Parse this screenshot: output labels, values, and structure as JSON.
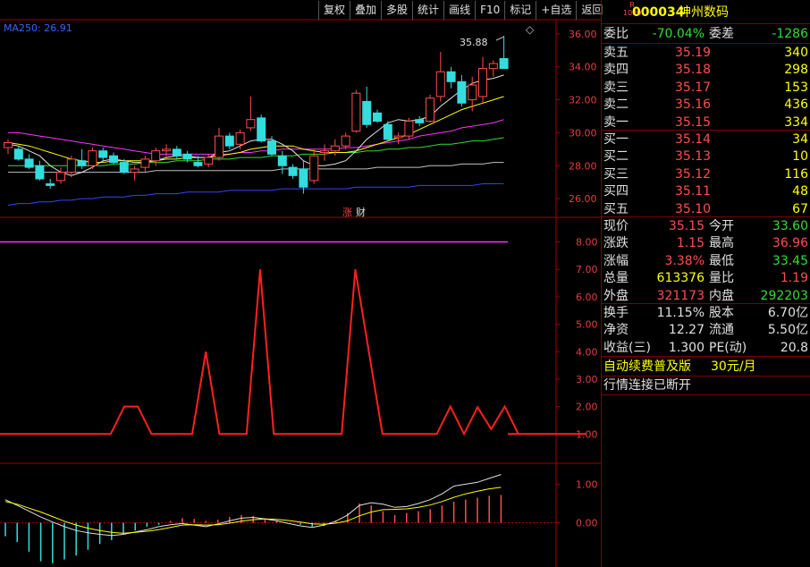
{
  "toolbar": {
    "buttons": [
      "复权",
      "叠加",
      "多股",
      "统计",
      "画线",
      "F10",
      "标记",
      "+自选",
      "返回"
    ]
  },
  "main_chart": {
    "ma_label": "MA250: 26.91",
    "max_label": "35.88",
    "y_ticks": [
      "36.00",
      "34.00",
      "32.00",
      "30.00",
      "28.00",
      "26.00"
    ],
    "markers": [
      "涨",
      "财"
    ],
    "icon": "diamond-icon"
  },
  "indicator_chart": {
    "y_ticks": [
      "8.00",
      "7.00",
      "6.00",
      "5.00",
      "4.00",
      "3.00",
      "2.00",
      "1.00"
    ]
  },
  "macd_chart": {
    "y_ticks": [
      "1.00",
      "0.00"
    ]
  },
  "stock": {
    "badge_top": "R",
    "badge_bottom": "1000",
    "code": "000034",
    "name": "神州数码"
  },
  "ratio": {
    "label1": "委比",
    "value1": "-70.04%",
    "label2": "委差",
    "value2": "-1286"
  },
  "asks": [
    {
      "label": "卖五",
      "price": "35.19",
      "vol": "340"
    },
    {
      "label": "卖四",
      "price": "35.18",
      "vol": "298"
    },
    {
      "label": "卖三",
      "price": "35.17",
      "vol": "153"
    },
    {
      "label": "卖二",
      "price": "35.16",
      "vol": "436"
    },
    {
      "label": "卖一",
      "price": "35.15",
      "vol": "334"
    }
  ],
  "bids": [
    {
      "label": "买一",
      "price": "35.14",
      "vol": "34"
    },
    {
      "label": "买二",
      "price": "35.13",
      "vol": "10"
    },
    {
      "label": "买三",
      "price": "35.12",
      "vol": "116"
    },
    {
      "label": "买四",
      "price": "35.11",
      "vol": "48"
    },
    {
      "label": "买五",
      "price": "35.10",
      "vol": "67"
    }
  ],
  "quote": [
    {
      "l1": "现价",
      "v1": "35.15",
      "c1": "red",
      "l2": "今开",
      "v2": "33.60",
      "c2": "grn"
    },
    {
      "l1": "涨跌",
      "v1": "1.15",
      "c1": "red",
      "l2": "最高",
      "v2": "36.96",
      "c2": "red"
    },
    {
      "l1": "涨幅",
      "v1": "3.38%",
      "c1": "red",
      "l2": "最低",
      "v2": "33.45",
      "c2": "grn"
    },
    {
      "l1": "总量",
      "v1": "613376",
      "c1": "yel",
      "l2": "量比",
      "v2": "1.19",
      "c2": "red"
    },
    {
      "l1": "外盘",
      "v1": "321173",
      "c1": "red",
      "l2": "内盘",
      "v2": "292203",
      "c2": "grn"
    }
  ],
  "fund": [
    {
      "l1": "换手",
      "v1": "11.15%",
      "l2": "股本",
      "v2": "6.70亿"
    },
    {
      "l1": "净资",
      "v1": "12.27",
      "l2": "流通",
      "v2": "5.50亿"
    },
    {
      "l1": "收益(三)",
      "v1": "1.300",
      "l2": "PE(动)",
      "v2": "20.8"
    }
  ],
  "promo": {
    "text": "自动续费普及版",
    "price": "30元/月"
  },
  "status": {
    "text": "行情连接已断开"
  },
  "colors": {
    "up": "#ff4d4d",
    "down": "#33dddd",
    "axis": "#a00000",
    "ma5": "#e0e0e0",
    "ma10": "#ffff00",
    "ma20": "#ff33ff",
    "ma30": "#33dd33",
    "ma60": "#c0c0c0",
    "ma250": "#3344ff",
    "indicator": "#ff2020",
    "macd_bar_up": "#ff4d4d",
    "macd_bar_down": "#33dddd"
  },
  "chart_data": {
    "type": "candlestick",
    "price_range": [
      25.3,
      36.7
    ],
    "candles": [
      {
        "o": 29.1,
        "h": 29.6,
        "l": 28.7,
        "c": 29.4
      },
      {
        "o": 29.0,
        "h": 29.2,
        "l": 28.3,
        "c": 28.4
      },
      {
        "o": 28.4,
        "h": 28.7,
        "l": 27.8,
        "c": 27.9
      },
      {
        "o": 28.0,
        "h": 28.3,
        "l": 27.1,
        "c": 27.2
      },
      {
        "o": 26.9,
        "h": 27.2,
        "l": 26.6,
        "c": 26.8
      },
      {
        "o": 27.1,
        "h": 27.9,
        "l": 26.9,
        "c": 27.6
      },
      {
        "o": 27.6,
        "h": 28.6,
        "l": 27.3,
        "c": 28.4
      },
      {
        "o": 28.3,
        "h": 29.0,
        "l": 27.8,
        "c": 28.0
      },
      {
        "o": 28.0,
        "h": 29.1,
        "l": 27.8,
        "c": 28.9
      },
      {
        "o": 28.9,
        "h": 29.1,
        "l": 28.2,
        "c": 28.5
      },
      {
        "o": 28.6,
        "h": 28.8,
        "l": 28.1,
        "c": 28.2
      },
      {
        "o": 28.2,
        "h": 28.4,
        "l": 27.5,
        "c": 27.6
      },
      {
        "o": 27.6,
        "h": 28.0,
        "l": 27.1,
        "c": 27.8
      },
      {
        "o": 27.9,
        "h": 28.6,
        "l": 27.6,
        "c": 28.4
      },
      {
        "o": 28.3,
        "h": 29.1,
        "l": 28.0,
        "c": 28.9
      },
      {
        "o": 28.9,
        "h": 29.3,
        "l": 28.5,
        "c": 29.0
      },
      {
        "o": 29.0,
        "h": 29.2,
        "l": 28.4,
        "c": 28.6
      },
      {
        "o": 28.7,
        "h": 28.9,
        "l": 28.2,
        "c": 28.4
      },
      {
        "o": 28.2,
        "h": 28.6,
        "l": 27.9,
        "c": 28.0
      },
      {
        "o": 28.1,
        "h": 28.7,
        "l": 27.9,
        "c": 28.5
      },
      {
        "o": 28.5,
        "h": 30.3,
        "l": 28.3,
        "c": 29.8
      },
      {
        "o": 29.8,
        "h": 30.0,
        "l": 29.0,
        "c": 29.2
      },
      {
        "o": 29.3,
        "h": 30.2,
        "l": 29.0,
        "c": 30.0
      },
      {
        "o": 30.3,
        "h": 32.2,
        "l": 30.1,
        "c": 30.8
      },
      {
        "o": 30.9,
        "h": 31.1,
        "l": 29.4,
        "c": 29.5
      },
      {
        "o": 29.5,
        "h": 29.8,
        "l": 28.6,
        "c": 28.7
      },
      {
        "o": 28.6,
        "h": 28.9,
        "l": 27.5,
        "c": 28.0
      },
      {
        "o": 27.9,
        "h": 28.1,
        "l": 27.2,
        "c": 27.4
      },
      {
        "o": 27.8,
        "h": 28.3,
        "l": 26.3,
        "c": 26.7
      },
      {
        "o": 27.1,
        "h": 29.0,
        "l": 26.9,
        "c": 28.6
      },
      {
        "o": 28.8,
        "h": 29.3,
        "l": 28.3,
        "c": 28.9
      },
      {
        "o": 28.9,
        "h": 29.6,
        "l": 28.6,
        "c": 29.2
      },
      {
        "o": 29.2,
        "h": 30.0,
        "l": 29.0,
        "c": 29.8
      },
      {
        "o": 30.1,
        "h": 32.6,
        "l": 30.0,
        "c": 32.4
      },
      {
        "o": 31.9,
        "h": 32.8,
        "l": 30.3,
        "c": 30.5
      },
      {
        "o": 31.2,
        "h": 31.4,
        "l": 30.6,
        "c": 30.7
      },
      {
        "o": 30.5,
        "h": 30.7,
        "l": 29.5,
        "c": 29.6
      },
      {
        "o": 29.7,
        "h": 30.0,
        "l": 29.3,
        "c": 29.8
      },
      {
        "o": 29.8,
        "h": 30.9,
        "l": 29.6,
        "c": 30.7
      },
      {
        "o": 30.8,
        "h": 31.0,
        "l": 30.4,
        "c": 30.6
      },
      {
        "o": 30.7,
        "h": 32.3,
        "l": 30.6,
        "c": 32.1
      },
      {
        "o": 32.2,
        "h": 34.9,
        "l": 31.9,
        "c": 33.7
      },
      {
        "o": 33.7,
        "h": 34.0,
        "l": 32.7,
        "c": 33.1
      },
      {
        "o": 33.1,
        "h": 33.5,
        "l": 31.6,
        "c": 31.8
      },
      {
        "o": 32.0,
        "h": 33.4,
        "l": 31.3,
        "c": 32.9
      },
      {
        "o": 32.2,
        "h": 34.6,
        "l": 31.8,
        "c": 33.9
      },
      {
        "o": 33.9,
        "h": 34.4,
        "l": 33.4,
        "c": 34.2
      },
      {
        "o": 34.5,
        "h": 35.88,
        "l": 33.9,
        "c": 33.9
      }
    ],
    "ma5": [
      29.3,
      29.2,
      28.9,
      28.6,
      28.0,
      27.6,
      27.4,
      27.6,
      27.9,
      28.3,
      28.4,
      28.3,
      28.2,
      28.2,
      28.3,
      28.5,
      28.6,
      28.6,
      28.5,
      28.5,
      28.8,
      28.9,
      29.2,
      29.5,
      29.6,
      29.6,
      29.3,
      28.9,
      28.3,
      28.0,
      28.0,
      28.1,
      28.3,
      28.9,
      29.6,
      30.1,
      30.6,
      30.8,
      30.7,
      30.8,
      31.0,
      31.6,
      32.1,
      32.6,
      33.0,
      33.2,
      33.3,
      33.5
    ],
    "ma10": [
      29.4,
      29.3,
      29.2,
      29.0,
      28.8,
      28.6,
      28.4,
      28.3,
      28.2,
      28.2,
      28.3,
      28.3,
      28.3,
      28.3,
      28.3,
      28.4,
      28.4,
      28.5,
      28.5,
      28.5,
      28.6,
      28.7,
      28.8,
      29.0,
      29.1,
      29.2,
      29.2,
      29.2,
      29.0,
      28.9,
      28.8,
      28.8,
      28.8,
      28.9,
      29.1,
      29.3,
      29.5,
      29.7,
      29.9,
      30.2,
      30.5,
      30.8,
      31.1,
      31.4,
      31.6,
      31.8,
      32.0,
      32.2
    ],
    "ma20": [
      30.0,
      30.0,
      29.9,
      29.8,
      29.7,
      29.6,
      29.5,
      29.4,
      29.3,
      29.2,
      29.1,
      29.0,
      28.9,
      28.8,
      28.7,
      28.7,
      28.7,
      28.7,
      28.7,
      28.7,
      28.7,
      28.7,
      28.8,
      28.8,
      28.9,
      28.9,
      29.0,
      29.0,
      29.0,
      29.0,
      29.0,
      29.0,
      29.1,
      29.1,
      29.2,
      29.3,
      29.4,
      29.5,
      29.6,
      29.8,
      29.9,
      30.0,
      30.1,
      30.3,
      30.4,
      30.5,
      30.6,
      30.8
    ],
    "ma30": [
      28.0,
      28.0,
      28.0,
      28.0,
      28.0,
      28.0,
      28.0,
      28.0,
      28.0,
      28.0,
      28.1,
      28.1,
      28.1,
      28.2,
      28.2,
      28.2,
      28.3,
      28.3,
      28.3,
      28.4,
      28.4,
      28.4,
      28.5,
      28.5,
      28.5,
      28.6,
      28.6,
      28.6,
      28.7,
      28.7,
      28.7,
      28.8,
      28.8,
      28.8,
      28.9,
      28.9,
      29.0,
      29.0,
      29.1,
      29.1,
      29.2,
      29.3,
      29.3,
      29.4,
      29.5,
      29.5,
      29.6,
      29.7
    ],
    "ma60": [
      27.6,
      27.6,
      27.6,
      27.6,
      27.6,
      27.6,
      27.6,
      27.6,
      27.6,
      27.6,
      27.6,
      27.6,
      27.6,
      27.6,
      27.7,
      27.7,
      27.7,
      27.7,
      27.7,
      27.7,
      27.7,
      27.7,
      27.7,
      27.7,
      27.7,
      27.7,
      27.8,
      27.8,
      27.8,
      27.8,
      27.8,
      27.8,
      27.8,
      27.8,
      27.8,
      27.9,
      27.9,
      27.9,
      27.9,
      27.9,
      28.0,
      28.0,
      28.0,
      28.1,
      28.1,
      28.1,
      28.2,
      28.2
    ],
    "ma250": [
      25.6,
      25.7,
      25.7,
      25.8,
      25.8,
      25.9,
      25.9,
      26.0,
      26.0,
      26.1,
      26.1,
      26.1,
      26.2,
      26.2,
      26.3,
      26.3,
      26.3,
      26.4,
      26.4,
      26.4,
      26.4,
      26.5,
      26.5,
      26.5,
      26.5,
      26.5,
      26.6,
      26.6,
      26.6,
      26.6,
      26.6,
      26.6,
      26.6,
      26.7,
      26.7,
      26.7,
      26.7,
      26.7,
      26.7,
      26.8,
      26.8,
      26.8,
      26.8,
      26.8,
      26.8,
      26.9,
      26.9,
      26.91
    ],
    "indicator": {
      "range": [
        0,
        8.8
      ],
      "values": [
        1,
        1,
        1,
        1,
        1,
        2,
        2,
        1,
        1,
        1,
        1,
        4,
        1,
        1,
        1,
        7,
        1,
        1,
        1,
        1,
        1,
        1,
        7,
        4,
        1,
        1,
        1,
        1,
        1,
        2,
        1,
        1.98,
        1.18,
        2,
        1,
        1,
        1,
        1,
        1,
        1
      ],
      "x_start": 63,
      "x_step": 15.2,
      "level_line": 8
    },
    "macd": {
      "range": [
        -1.1,
        1.45
      ],
      "dif": [
        0.6,
        0.45,
        0.3,
        0.15,
        0.02,
        -0.1,
        -0.2,
        -0.26,
        -0.3,
        -0.33,
        -0.3,
        -0.24,
        -0.18,
        -0.1,
        -0.05,
        -0.02,
        -0.06,
        -0.1,
        -0.03,
        0.05,
        0.12,
        0.14,
        0.1,
        0.05,
        -0.02,
        -0.08,
        -0.12,
        -0.06,
        0.04,
        0.2,
        0.45,
        0.52,
        0.48,
        0.4,
        0.42,
        0.5,
        0.6,
        0.75,
        0.95,
        1.0,
        1.05,
        1.15,
        1.25
      ],
      "dea": [
        0.55,
        0.48,
        0.38,
        0.28,
        0.16,
        0.04,
        -0.06,
        -0.14,
        -0.2,
        -0.25,
        -0.27,
        -0.25,
        -0.22,
        -0.18,
        -0.12,
        -0.06,
        -0.05,
        -0.06,
        -0.05,
        -0.01,
        0.04,
        0.08,
        0.1,
        0.09,
        0.06,
        0.02,
        -0.03,
        -0.04,
        -0.01,
        0.05,
        0.18,
        0.28,
        0.34,
        0.35,
        0.36,
        0.4,
        0.46,
        0.55,
        0.66,
        0.75,
        0.82,
        0.88,
        0.92
      ],
      "bars": [
        -0.35,
        -0.5,
        -0.75,
        -1.0,
        -1.05,
        -0.95,
        -0.85,
        -0.7,
        -0.55,
        -0.45,
        -0.3,
        -0.2,
        -0.1,
        -0.05,
        0.05,
        0.12,
        0.1,
        0.05,
        0.08,
        0.15,
        0.2,
        0.18,
        0.1,
        0.05,
        0.0,
        -0.05,
        -0.1,
        -0.08,
        0.06,
        0.25,
        0.5,
        0.45,
        0.3,
        0.2,
        0.25,
        0.3,
        0.35,
        0.45,
        0.55,
        0.6,
        0.65,
        0.7,
        0.72
      ]
    }
  }
}
